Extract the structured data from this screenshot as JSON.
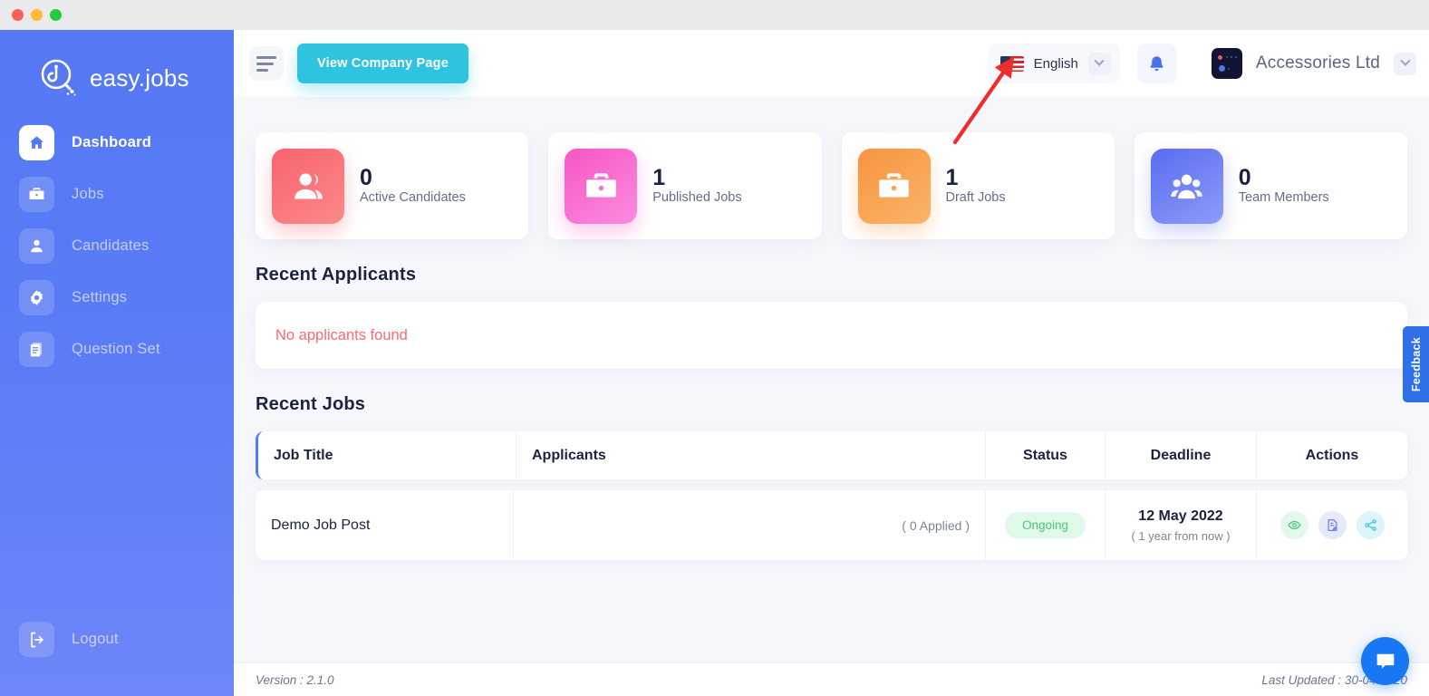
{
  "window": {
    "title": ""
  },
  "sidebar": {
    "brand": "easy.jobs",
    "items": [
      {
        "label": "Dashboard",
        "icon": "home-icon",
        "active": true
      },
      {
        "label": "Jobs",
        "icon": "briefcase-icon",
        "active": false
      },
      {
        "label": "Candidates",
        "icon": "user-icon",
        "active": false
      },
      {
        "label": "Settings",
        "icon": "gear-icon",
        "active": false
      },
      {
        "label": "Question Set",
        "icon": "document-icon",
        "active": false
      }
    ],
    "logout": {
      "label": "Logout",
      "icon": "logout-icon"
    }
  },
  "topbar": {
    "menu_icon": "hamburger-icon",
    "view_company_label": "View Company Page",
    "language": {
      "value": "English",
      "flag": "us-flag-icon",
      "chevron": "chevron-down-icon"
    },
    "notification_icon": "bell-icon",
    "account": {
      "name": "Accessories Ltd",
      "avatar": "company-avatar",
      "chevron": "chevron-down-icon"
    }
  },
  "stats": [
    {
      "value": "0",
      "label": "Active Candidates",
      "icon": "candidates-icon",
      "color_from": "#f9626f",
      "color_to": "#f98d8d"
    },
    {
      "value": "1",
      "label": "Published Jobs",
      "icon": "briefcase-icon",
      "color_from": "#f755c3",
      "color_to": "#fb8ae0"
    },
    {
      "value": "1",
      "label": "Draft Jobs",
      "icon": "briefcase-icon",
      "color_from": "#f79440",
      "color_to": "#fbb267"
    },
    {
      "value": "0",
      "label": "Team Members",
      "icon": "team-icon",
      "color_from": "#5a6cf0",
      "color_to": "#8b9bf7"
    }
  ],
  "recent_applicants": {
    "title": "Recent Applicants",
    "empty_message": "No applicants found",
    "empty_color": "#fb6a73"
  },
  "recent_jobs": {
    "title": "Recent Jobs",
    "columns": [
      "Job Title",
      "Applicants",
      "Status",
      "Deadline",
      "Actions"
    ],
    "rows": [
      {
        "job_title": "Demo Job Post",
        "applicants": "( 0 Applied )",
        "status": "Ongoing",
        "status_color": "#48c97a",
        "deadline_date": "12 May 2022",
        "deadline_relative": "( 1 year from now )",
        "actions": [
          "eye-icon",
          "edit-document-icon",
          "share-icon"
        ]
      }
    ]
  },
  "footer": {
    "version": "Version : 2.1.0",
    "last_updated": "Last Updated : 30-04-2020"
  },
  "feedback_tab": {
    "label": "Feedback",
    "color": "#2f6fe8"
  },
  "chat_widget": {
    "icon": "chat-bubble-icon",
    "color": "#1877f2"
  },
  "annotation": {
    "type": "arrow",
    "color": "#ef2b2b",
    "points_to": "language-selector"
  }
}
